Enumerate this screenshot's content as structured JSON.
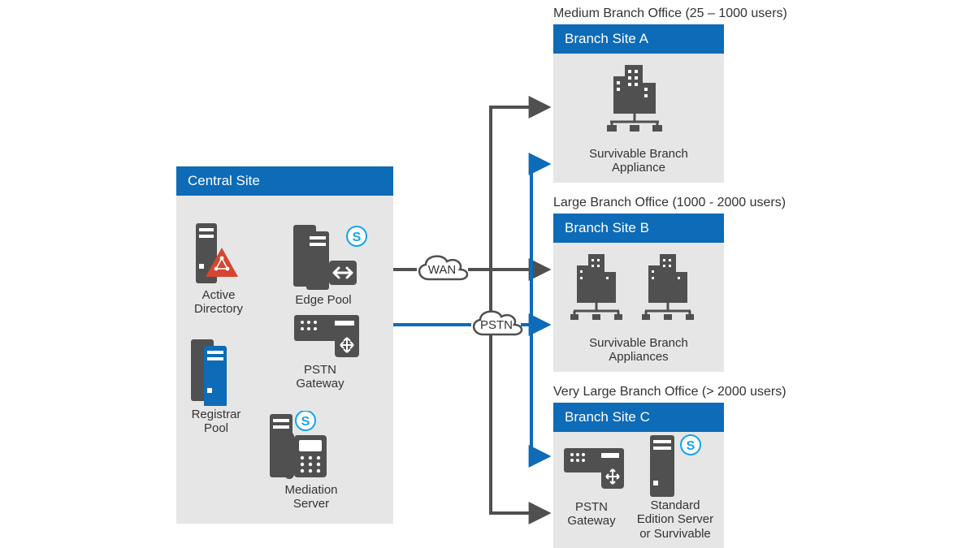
{
  "colors": {
    "blue": "#0d6bb7",
    "panel": "#e6e6e6",
    "dark": "#505050",
    "red": "#d64531",
    "skype": "#12a5ed"
  },
  "central": {
    "title": "Central Site",
    "active_directory": "Active\nDirectory",
    "registrar_pool": "Registrar\nPool",
    "edge_pool": "Edge Pool",
    "pstn_gateway": "PSTN\nGateway",
    "mediation_server": "Mediation\nServer"
  },
  "clouds": {
    "wan": "WAN",
    "pstn": "PSTN"
  },
  "branch_a": {
    "caption": "Medium Branch Office (25 – 1000 users)",
    "title": "Branch Site A",
    "appliance": "Survivable Branch\nAppliance"
  },
  "branch_b": {
    "caption": "Large Branch Office (1000 - 2000 users)",
    "title": "Branch Site B",
    "appliances": "Survivable Branch\nAppliances"
  },
  "branch_c": {
    "caption": "Very Large Branch Office (> 2000 users)",
    "title": "Branch Site C",
    "pstn_gateway": "PSTN\nGateway",
    "server": "Standard\nEdition Server\nor Survivable"
  }
}
